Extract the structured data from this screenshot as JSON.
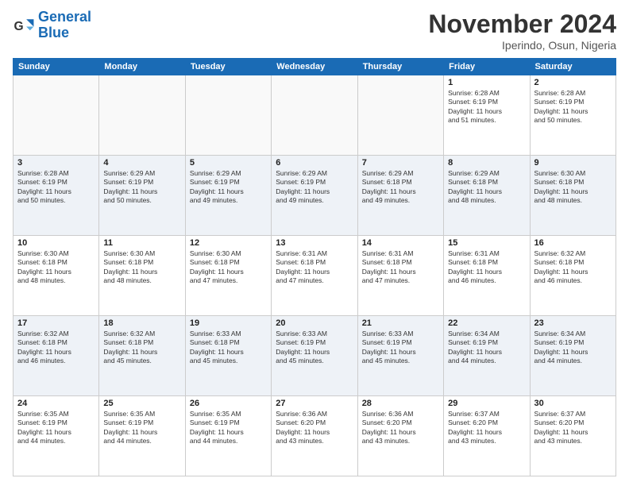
{
  "header": {
    "logo_general": "General",
    "logo_blue": "Blue",
    "month_title": "November 2024",
    "subtitle": "Iperindo, Osun, Nigeria"
  },
  "weekdays": [
    "Sunday",
    "Monday",
    "Tuesday",
    "Wednesday",
    "Thursday",
    "Friday",
    "Saturday"
  ],
  "weeks": [
    [
      {
        "day": "",
        "info": ""
      },
      {
        "day": "",
        "info": ""
      },
      {
        "day": "",
        "info": ""
      },
      {
        "day": "",
        "info": ""
      },
      {
        "day": "",
        "info": ""
      },
      {
        "day": "1",
        "info": "Sunrise: 6:28 AM\nSunset: 6:19 PM\nDaylight: 11 hours\nand 51 minutes."
      },
      {
        "day": "2",
        "info": "Sunrise: 6:28 AM\nSunset: 6:19 PM\nDaylight: 11 hours\nand 50 minutes."
      }
    ],
    [
      {
        "day": "3",
        "info": "Sunrise: 6:28 AM\nSunset: 6:19 PM\nDaylight: 11 hours\nand 50 minutes."
      },
      {
        "day": "4",
        "info": "Sunrise: 6:29 AM\nSunset: 6:19 PM\nDaylight: 11 hours\nand 50 minutes."
      },
      {
        "day": "5",
        "info": "Sunrise: 6:29 AM\nSunset: 6:19 PM\nDaylight: 11 hours\nand 49 minutes."
      },
      {
        "day": "6",
        "info": "Sunrise: 6:29 AM\nSunset: 6:19 PM\nDaylight: 11 hours\nand 49 minutes."
      },
      {
        "day": "7",
        "info": "Sunrise: 6:29 AM\nSunset: 6:18 PM\nDaylight: 11 hours\nand 49 minutes."
      },
      {
        "day": "8",
        "info": "Sunrise: 6:29 AM\nSunset: 6:18 PM\nDaylight: 11 hours\nand 48 minutes."
      },
      {
        "day": "9",
        "info": "Sunrise: 6:30 AM\nSunset: 6:18 PM\nDaylight: 11 hours\nand 48 minutes."
      }
    ],
    [
      {
        "day": "10",
        "info": "Sunrise: 6:30 AM\nSunset: 6:18 PM\nDaylight: 11 hours\nand 48 minutes."
      },
      {
        "day": "11",
        "info": "Sunrise: 6:30 AM\nSunset: 6:18 PM\nDaylight: 11 hours\nand 48 minutes."
      },
      {
        "day": "12",
        "info": "Sunrise: 6:30 AM\nSunset: 6:18 PM\nDaylight: 11 hours\nand 47 minutes."
      },
      {
        "day": "13",
        "info": "Sunrise: 6:31 AM\nSunset: 6:18 PM\nDaylight: 11 hours\nand 47 minutes."
      },
      {
        "day": "14",
        "info": "Sunrise: 6:31 AM\nSunset: 6:18 PM\nDaylight: 11 hours\nand 47 minutes."
      },
      {
        "day": "15",
        "info": "Sunrise: 6:31 AM\nSunset: 6:18 PM\nDaylight: 11 hours\nand 46 minutes."
      },
      {
        "day": "16",
        "info": "Sunrise: 6:32 AM\nSunset: 6:18 PM\nDaylight: 11 hours\nand 46 minutes."
      }
    ],
    [
      {
        "day": "17",
        "info": "Sunrise: 6:32 AM\nSunset: 6:18 PM\nDaylight: 11 hours\nand 46 minutes."
      },
      {
        "day": "18",
        "info": "Sunrise: 6:32 AM\nSunset: 6:18 PM\nDaylight: 11 hours\nand 45 minutes."
      },
      {
        "day": "19",
        "info": "Sunrise: 6:33 AM\nSunset: 6:18 PM\nDaylight: 11 hours\nand 45 minutes."
      },
      {
        "day": "20",
        "info": "Sunrise: 6:33 AM\nSunset: 6:19 PM\nDaylight: 11 hours\nand 45 minutes."
      },
      {
        "day": "21",
        "info": "Sunrise: 6:33 AM\nSunset: 6:19 PM\nDaylight: 11 hours\nand 45 minutes."
      },
      {
        "day": "22",
        "info": "Sunrise: 6:34 AM\nSunset: 6:19 PM\nDaylight: 11 hours\nand 44 minutes."
      },
      {
        "day": "23",
        "info": "Sunrise: 6:34 AM\nSunset: 6:19 PM\nDaylight: 11 hours\nand 44 minutes."
      }
    ],
    [
      {
        "day": "24",
        "info": "Sunrise: 6:35 AM\nSunset: 6:19 PM\nDaylight: 11 hours\nand 44 minutes."
      },
      {
        "day": "25",
        "info": "Sunrise: 6:35 AM\nSunset: 6:19 PM\nDaylight: 11 hours\nand 44 minutes."
      },
      {
        "day": "26",
        "info": "Sunrise: 6:35 AM\nSunset: 6:19 PM\nDaylight: 11 hours\nand 44 minutes."
      },
      {
        "day": "27",
        "info": "Sunrise: 6:36 AM\nSunset: 6:20 PM\nDaylight: 11 hours\nand 43 minutes."
      },
      {
        "day": "28",
        "info": "Sunrise: 6:36 AM\nSunset: 6:20 PM\nDaylight: 11 hours\nand 43 minutes."
      },
      {
        "day": "29",
        "info": "Sunrise: 6:37 AM\nSunset: 6:20 PM\nDaylight: 11 hours\nand 43 minutes."
      },
      {
        "day": "30",
        "info": "Sunrise: 6:37 AM\nSunset: 6:20 PM\nDaylight: 11 hours\nand 43 minutes."
      }
    ]
  ]
}
